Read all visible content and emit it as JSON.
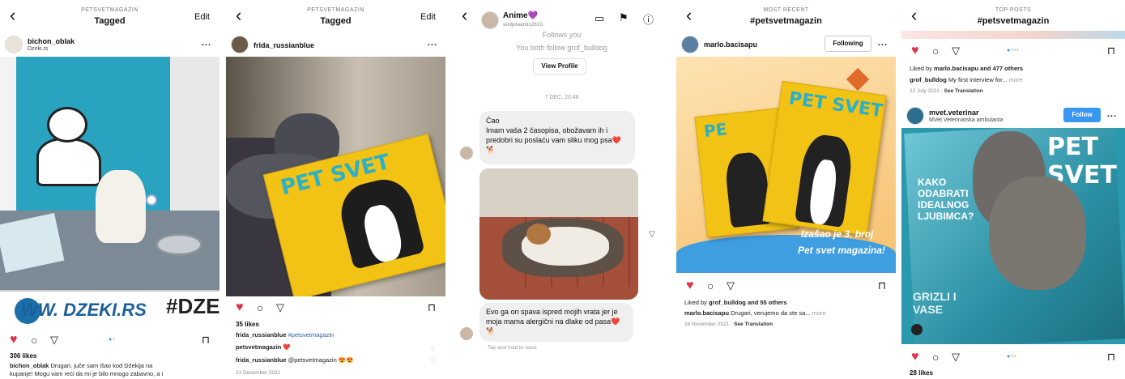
{
  "p1": {
    "subtitle": "PETSVETMAGAZIN",
    "title": "Tagged",
    "edit": "Edit",
    "user": "bichon_oblak",
    "user_sub": "Dzeki.rs",
    "more": "...",
    "sign_text": "WW. DZEKI.RS",
    "sign_text2": "#DZE",
    "likes": "306 likes",
    "caption_user": "bichon_oblak",
    "caption": "Drugari, juče sam išao kod Džekija na",
    "caption2": "kupanje! Mogu vam reći da mi je bilo mnogo zabavno, a i"
  },
  "p2": {
    "subtitle": "PETSVETMAGAZIN",
    "title": "Tagged",
    "edit": "Edit",
    "user": "frida_russianblue",
    "more": "...",
    "mag_title": "PET SVET",
    "likes": "35 likes",
    "c1_user": "frida_russianblue",
    "c1": "#petsvetmagazin",
    "c2_user": "petsvetmagazin",
    "c2": "❤️",
    "c3_user": "frida_russianblue",
    "c3": "@petsvetmagazin 😍😍",
    "date": "21 December 2021"
  },
  "p3": {
    "name": "Anime💜",
    "handle": "andjelaantic2610",
    "follows": "Follows you",
    "both": "You both follow grof_bulldog",
    "view_profile": "View Profile",
    "timestamp": "7 DEC, 20:48",
    "msg1": "Ćao\nImam vaša 2 časopisa, obožavam ih i predobri su poslaću vam sliku mog psa❤️🐕",
    "msg2": "Evo ga on spava ispred mojih vrata jer je moja mama alergični na dlake od pasa❤️🐕",
    "hint": "Tap and hold to react"
  },
  "p4": {
    "subtitle": "MOST RECENT",
    "title": "#petsvetmagazin",
    "user": "marlo.bacisapu",
    "following": "Following",
    "more": "...",
    "promo1": "Izašao je 3. broj",
    "promo2": "Pet svet magazina!",
    "liked_by": "Liked by",
    "liked_user": "grof_bulldog",
    "liked_rest": "and 55 others",
    "cap_user": "marlo.bacisapu",
    "cap": "Drugari, verujemo da ste sa...",
    "cap_more": "more",
    "date": "24 November 2021",
    "see_tr": "See Translation"
  },
  "p5": {
    "subtitle": "TOP POSTS",
    "title": "#petsvetmagazin",
    "liked_by": "Liked by",
    "liked_user": "marlo.bacisapu",
    "liked_rest": "and 477 others",
    "cap_user": "grof_bulldog",
    "cap": "My first interview for...",
    "cap_more": "more",
    "date": "22 July 2021",
    "see_tr": "See Translation",
    "user2": "mvet.veterinar",
    "user2_sub": "MVet Veterinarska ambulanta",
    "follow": "Follow",
    "more": "...",
    "mag_title": "PET SVET",
    "cover1": "KAKO ODABRATI IDEALNOG LJUBIMCA?",
    "cover2": "GRIZLI I VASE",
    "likes2": "28 likes"
  }
}
